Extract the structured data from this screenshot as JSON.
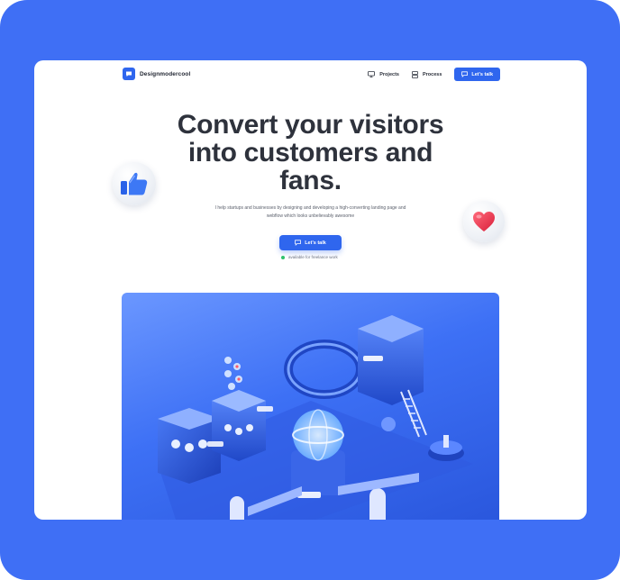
{
  "brand": {
    "name": "Designmodercool"
  },
  "nav": {
    "projects": "Projects",
    "process": "Process",
    "cta": "Let's talk"
  },
  "hero": {
    "title_line1": "Convert your visitors",
    "title_line2": "into customers and",
    "title_line3": "fans.",
    "subtitle_line1": "I help startups and businesses by designing and developing a high-converting landing page and",
    "subtitle_line2": "webflow which looks unbelievably awesome",
    "cta": "Let's talk",
    "availability": "available for freelance work"
  },
  "colors": {
    "background": "#3f6ff5",
    "accent": "#2f66ee",
    "text": "#2e323c",
    "available": "#2fc26c"
  },
  "icons": {
    "logo": "chat-bubble-icon",
    "projects": "monitor-icon",
    "process": "layers-icon",
    "cta": "message-icon",
    "thumb": "thumbs-up-icon",
    "heart": "heart-icon"
  }
}
